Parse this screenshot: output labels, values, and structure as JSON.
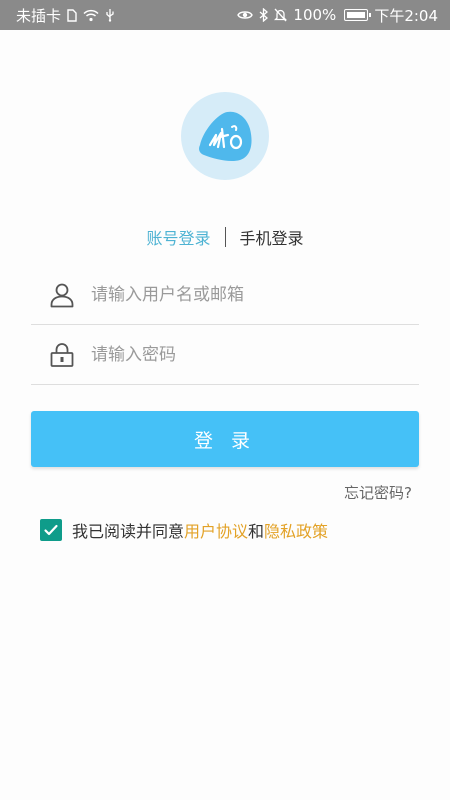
{
  "status_bar": {
    "carrier": "未插卡",
    "battery": "100%",
    "time": "下午2:04"
  },
  "login": {
    "tabs": [
      {
        "label": "账号登录",
        "active": true
      },
      {
        "label": "手机登录",
        "active": false
      }
    ],
    "username": {
      "placeholder": "请输入用户名或邮箱",
      "value": ""
    },
    "password": {
      "placeholder": "请输入密码",
      "value": ""
    },
    "submit_label": "登 录",
    "forgot_label": "忘记密码?",
    "agreement": {
      "checked": true,
      "prefix": "我已阅读并同意",
      "user_agreement": "用户协议",
      "and": "和",
      "privacy_policy": "隐私政策"
    }
  },
  "colors": {
    "accent": "#45c1f7",
    "tab_active": "#4eb3d3",
    "checkbox": "#0f9c8a",
    "link": "#e3a227",
    "status_bar": "#8a8a8a"
  }
}
